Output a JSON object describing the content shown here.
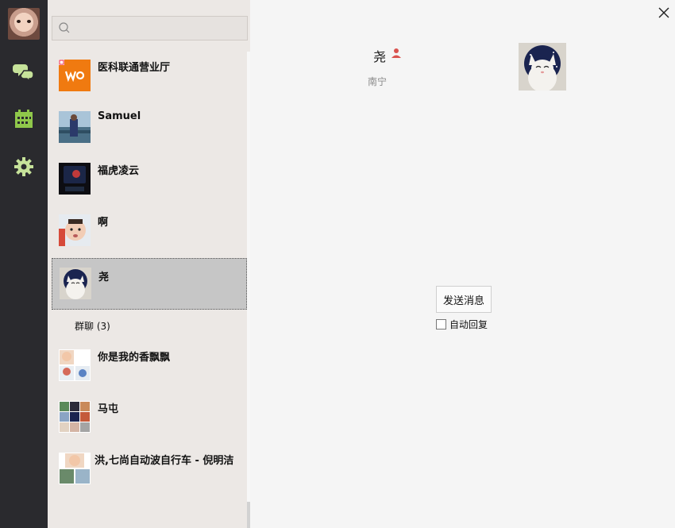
{
  "sidebar": {
    "items": [
      {
        "icon": "chat-bubbles-icon"
      },
      {
        "icon": "calendar-icon"
      },
      {
        "icon": "gear-icon"
      }
    ],
    "accent": "#c6e29a"
  },
  "search": {
    "placeholder": "",
    "value": ""
  },
  "conversations": [
    {
      "name": "医科联通营业厅"
    },
    {
      "name": "Samuel"
    },
    {
      "name": "福虎凌云"
    },
    {
      "name": "啊"
    },
    {
      "name": "尧",
      "selected": true
    }
  ],
  "group_section": {
    "label": "群聊",
    "count": "(3)"
  },
  "groups": [
    {
      "name": "你是我的香飘飘"
    },
    {
      "name": "马屯"
    },
    {
      "name": "洪,七尚自动波自行车 - 倪明洁"
    }
  ],
  "detail": {
    "name": "尧",
    "region": "南宁",
    "send_label": "发送消息",
    "auto_reply_label": "自动回复",
    "auto_reply_checked": false
  },
  "colors": {
    "rail_bg": "#2a2a2e",
    "list_bg": "#ece8e5",
    "selected_bg": "#c6c6c6",
    "gender_icon": "#d9534f"
  }
}
